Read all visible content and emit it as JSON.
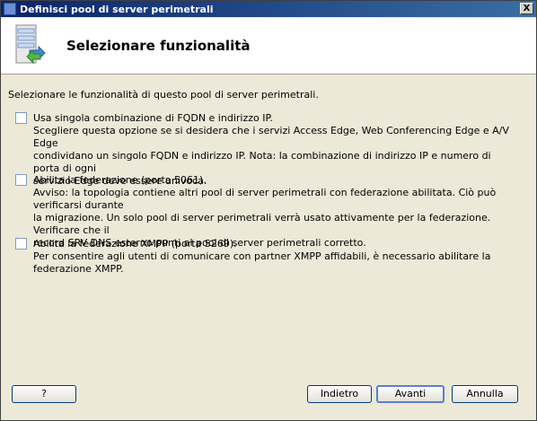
{
  "window": {
    "title": "Definisci pool di server perimetrali",
    "close_label": "X"
  },
  "header": {
    "title": "Selezionare funzionalità"
  },
  "intro": "Selezionare le funzionalità di questo pool di server perimetrali.",
  "options": [
    {
      "label": "Usa singola combinazione di FQDN e indirizzo IP.",
      "checked": false,
      "description": [
        "Scegliere questa opzione se si desidera che i servizi Access Edge, Web Conferencing Edge e A/V Edge",
        "condividano un singolo FQDN e indirizzo IP. Nota: la combinazione di indirizzo IP e numero di porta di ogni",
        "servizio Edge deve essere univoca."
      ]
    },
    {
      "label": "Abilita la federazione (porta 5061).",
      "checked": false,
      "description": [
        "Avviso: la topologia contiene altri pool di server perimetrali con federazione abilitata. Ciò può verificarsi durante",
        "la migrazione.  Un solo pool di server perimetrali verrà usato attivamente per la federazione.  Verificare che il",
        "record SRV DNS esterno punti al pool di server perimetrali corretto."
      ]
    },
    {
      "label": "Abilita la federazione XMPP (porta 5269).",
      "checked": false,
      "description": [
        "Per consentire agli utenti di comunicare con partner XMPP affidabili, è necessario abilitare la federazione XMPP."
      ]
    }
  ],
  "buttons": {
    "help": "?",
    "back": "Indietro",
    "next": "Avanti",
    "cancel": "Annulla"
  }
}
